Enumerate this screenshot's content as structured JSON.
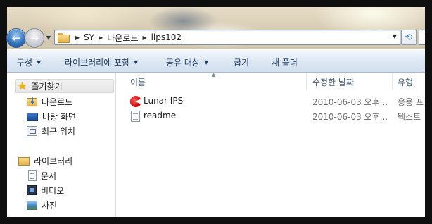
{
  "address": {
    "path": [
      "SY",
      "다운로드",
      "lips102"
    ]
  },
  "toolbar": {
    "organize": "구성",
    "include_library": "라이브러리에 포함",
    "share_with": "공유 대상",
    "burn": "굽기",
    "new_folder": "새 폴더"
  },
  "navigation": {
    "favorites": "즐겨찾기",
    "favorites_items": [
      "다운로드",
      "바탕 화면",
      "최근 위치"
    ],
    "libraries": "라이브러리",
    "library_items": [
      "문서",
      "비디오",
      "사진"
    ]
  },
  "columns": {
    "name": "이름",
    "date_modified": "수정한 날짜",
    "type": "유형"
  },
  "files": [
    {
      "name": "Lunar IPS",
      "date": "2010-06-03 오후...",
      "type": "응용 프",
      "icon": "lunar-ips-icon"
    },
    {
      "name": "readme",
      "date": "2010-06-03 오후...",
      "type": "텍스트",
      "icon": "text-file-icon"
    }
  ],
  "colors": {
    "accent": "#1e395b",
    "window_frame": "#0f0f0f",
    "commandbar_top": "#f5f9fd",
    "commandbar_bottom": "#d1dfee"
  }
}
